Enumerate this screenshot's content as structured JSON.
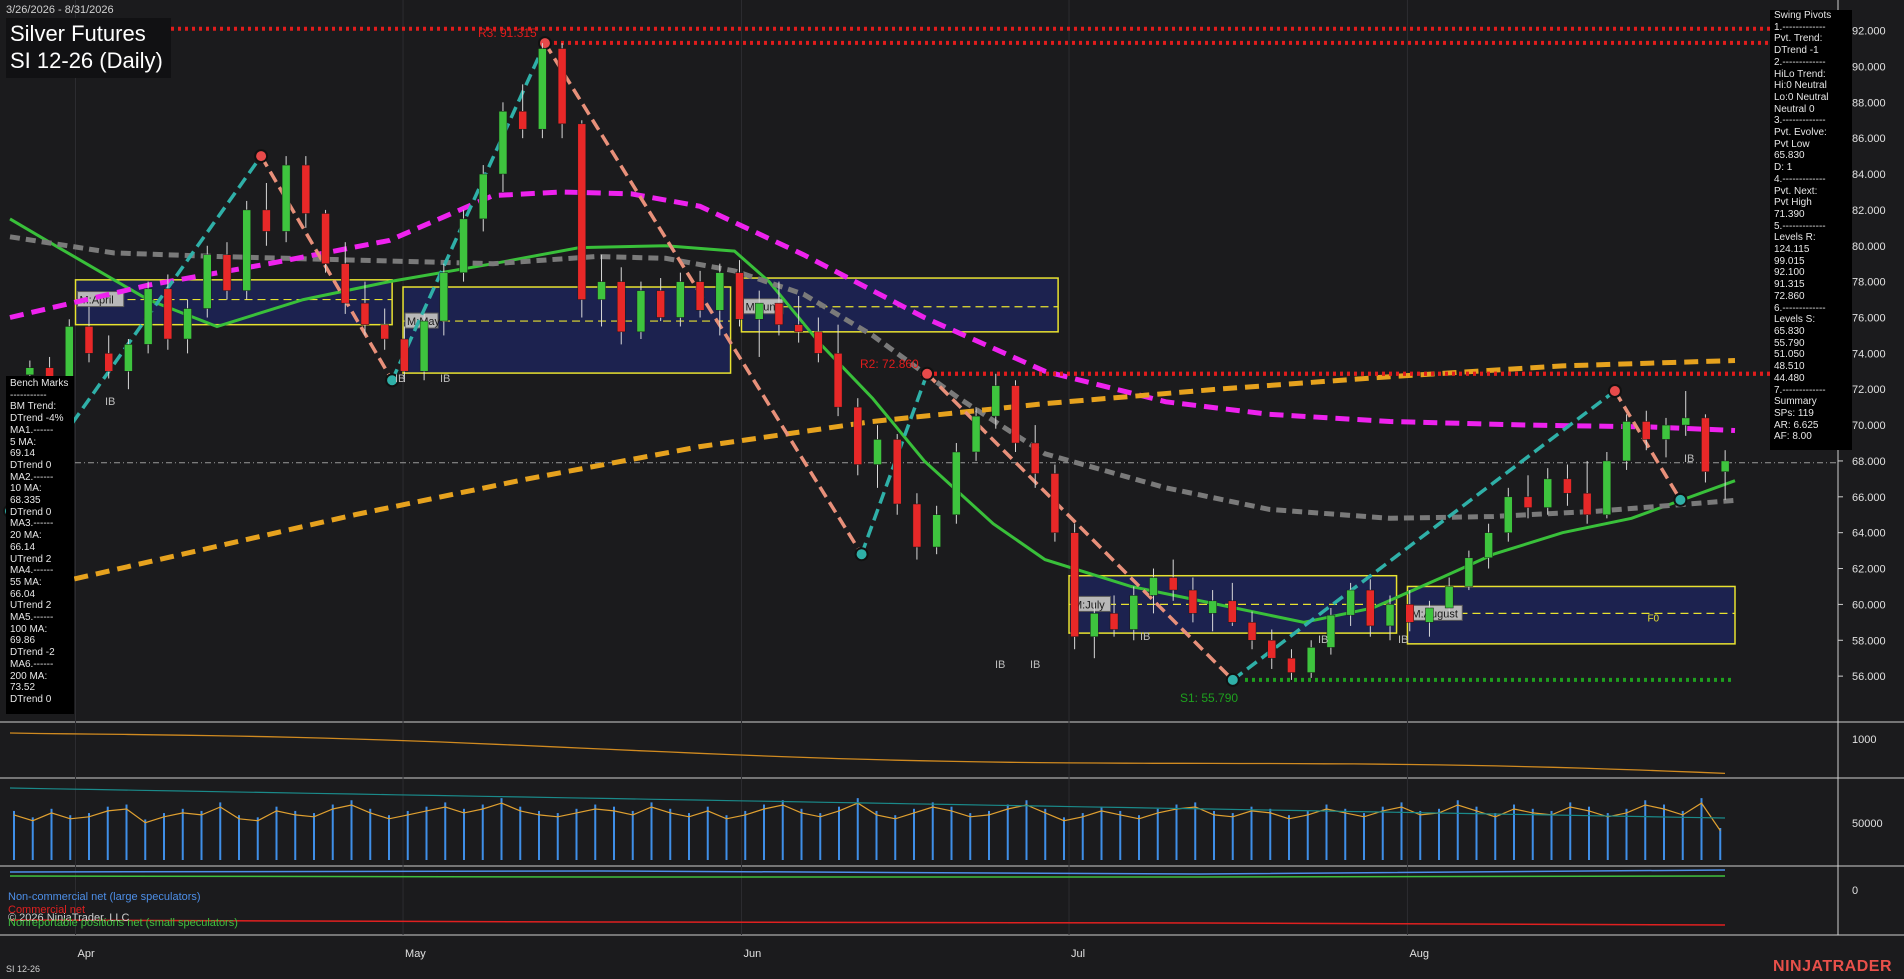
{
  "header": {
    "date_range": "3/26/2026 - 8/31/2026",
    "instrument": "Silver Futures",
    "contract": "SI 12-26 (Daily)"
  },
  "footer": {
    "symbol": "SI 12-26",
    "brand": "NINJATRADER",
    "copyright": "© 2026 NinjaTrader, LLC"
  },
  "cot_legend": {
    "noncommercial": "Non-commercial net (large speculators)",
    "commercial": "Commercial net",
    "nonreportable": "Nonreportable positions net (small speculators)"
  },
  "swing_panel": [
    "Swing Pivots",
    "1.-------------",
    "Pvt. Trend:",
    "DTrend -1",
    "2.-------------",
    "HiLo Trend:",
    "Hi:0 Neutral",
    "Lo:0 Neutral",
    "Neutral 0",
    "3.-------------",
    "Pvt. Evolve:",
    "Pvt Low",
    "65.830",
    "D: 1",
    "4.-------------",
    "Pvt. Next:",
    "Pvt High",
    "71.390",
    "5.-------------",
    "Levels R:",
    "124.115",
    "99.015",
    "92.100",
    "91.315",
    "72.860",
    "6.-------------",
    "Levels S:",
    "65.830",
    "55.790",
    "51.050",
    "48.510",
    "44.480",
    "7.-------------",
    "Summary",
    "SPs: 119",
    "AR: 6.625",
    "AF: 8.00"
  ],
  "bench_panel": [
    "Bench Marks",
    "-----------",
    "BM Trend:",
    "DTrend -4%",
    "MA1.------",
    "5 MA:",
    "69.14",
    "DTrend 0",
    "MA2.------",
    "10 MA:",
    "68.335",
    "DTrend 0",
    "MA3.------",
    "20 MA:",
    "66.14",
    "UTrend 2",
    "MA4.------",
    "55 MA:",
    "66.04",
    "UTrend 2",
    "MA5.------",
    "100 MA:",
    "69.86",
    "DTrend -2",
    "MA6.------",
    "200 MA:",
    "73.52",
    "DTrend 0"
  ],
  "chart_data": {
    "type": "candlestick",
    "x_axis": {
      "ticks": [
        "Apr",
        "May",
        "Jun",
        "Jul",
        "Aug"
      ]
    },
    "y_axis": {
      "range": [
        54,
        93
      ],
      "ticks": [
        "56.000",
        "58.000",
        "60.000",
        "62.000",
        "64.000",
        "66.000",
        "68.000",
        "70.000",
        "72.000",
        "74.000",
        "76.000",
        "78.000",
        "80.000",
        "82.000",
        "84.000",
        "86.000",
        "88.000",
        "90.000",
        "92.000"
      ]
    },
    "sub_axes": {
      "oi_tick": "1000",
      "volume_tick": "50000",
      "cot_tick": "0"
    },
    "levels": [
      {
        "label": "R3: 91.315",
        "value": 91.315,
        "color": "#e01c1c"
      },
      {
        "label": "",
        "value": 92.1,
        "color": "#e01c1c"
      },
      {
        "label": "R2: 72.860",
        "value": 72.86,
        "color": "#e01c1c"
      },
      {
        "label": "",
        "value": 72.86,
        "color": "#e01c1c"
      },
      {
        "label": "S1: 55.790",
        "value": 55.79,
        "color": "#1ea01e"
      }
    ],
    "last_price": 67.9,
    "swing_points": [
      {
        "date": "2026-03-26",
        "value": 65.2
      },
      {
        "date": "2026-04-18",
        "value": 85.0
      },
      {
        "date": "2026-04-30",
        "value": 72.5
      },
      {
        "date": "2026-05-14",
        "value": 91.3
      },
      {
        "date": "2026-06-12",
        "value": 62.8
      },
      {
        "date": "2026-06-18",
        "value": 72.86
      },
      {
        "date": "2026-07-16",
        "value": 55.79
      },
      {
        "date": "2026-08-20",
        "value": 71.9
      },
      {
        "date": "2026-08-26",
        "value": 65.83
      }
    ],
    "monthly_boxes": [
      {
        "label": "M:April",
        "start": "2026-04-01",
        "end": "2026-04-30",
        "high": 78.1,
        "low": 75.6,
        "mid": 77.0
      },
      {
        "label": "M:May",
        "start": "2026-05-01",
        "end": "2026-05-31",
        "high": 77.7,
        "low": 72.9,
        "mid": 75.8
      },
      {
        "label": "M:June",
        "start": "2026-06-01",
        "end": "2026-06-30",
        "high": 78.2,
        "low": 75.2,
        "mid": 76.6
      },
      {
        "label": "M:July",
        "start": "2026-07-01",
        "end": "2026-07-31",
        "high": 61.6,
        "low": 58.4,
        "mid": 60.0
      },
      {
        "label": "M:August",
        "start": "2026-08-01",
        "end": "2026-08-31",
        "high": 61.0,
        "low": 57.8,
        "mid": 59.5
      }
    ],
    "box_tags": [
      "F0"
    ],
    "ib_marks": [
      "IB"
    ],
    "moving_averages": [
      {
        "name": "",
        "color": "#39c03a",
        "style": "solid",
        "points": [
          [
            0,
            81.5
          ],
          [
            0.03,
            79.8
          ],
          [
            0.08,
            77.0
          ],
          [
            0.12,
            75.5
          ],
          [
            0.17,
            77.0
          ],
          [
            0.22,
            78.0
          ],
          [
            0.28,
            79.0
          ],
          [
            0.33,
            79.9
          ],
          [
            0.38,
            80.0
          ],
          [
            0.42,
            79.7
          ],
          [
            0.44,
            78.0
          ],
          [
            0.47,
            74.5
          ],
          [
            0.5,
            71.5
          ],
          [
            0.53,
            68.0
          ],
          [
            0.57,
            64.5
          ],
          [
            0.6,
            62.5
          ],
          [
            0.65,
            61.0
          ],
          [
            0.7,
            60.0
          ],
          [
            0.75,
            59.0
          ],
          [
            0.79,
            59.8
          ],
          [
            0.83,
            61.5
          ],
          [
            0.86,
            62.8
          ],
          [
            0.9,
            64.0
          ],
          [
            0.94,
            64.8
          ],
          [
            1,
            66.9
          ]
        ]
      },
      {
        "name": "",
        "color": "#7a7a7a",
        "style": "dashed",
        "points": [
          [
            0,
            80.5
          ],
          [
            0.06,
            79.6
          ],
          [
            0.12,
            79.4
          ],
          [
            0.2,
            79.2
          ],
          [
            0.28,
            79.0
          ],
          [
            0.34,
            79.4
          ],
          [
            0.38,
            79.3
          ],
          [
            0.42,
            78.6
          ],
          [
            0.46,
            77.3
          ],
          [
            0.5,
            75.0
          ],
          [
            0.55,
            71.5
          ],
          [
            0.6,
            68.4
          ],
          [
            0.67,
            66.5
          ],
          [
            0.73,
            65.3
          ],
          [
            0.8,
            64.8
          ],
          [
            0.86,
            64.9
          ],
          [
            0.92,
            65.2
          ],
          [
            1,
            65.8
          ]
        ]
      },
      {
        "name": "",
        "color": "#ee22ee",
        "style": "dashed",
        "points": [
          [
            0,
            76.0
          ],
          [
            0.08,
            77.8
          ],
          [
            0.15,
            79.0
          ],
          [
            0.22,
            80.3
          ],
          [
            0.28,
            82.8
          ],
          [
            0.32,
            83.0
          ],
          [
            0.36,
            82.9
          ],
          [
            0.4,
            82.2
          ],
          [
            0.46,
            79.5
          ],
          [
            0.53,
            76.0
          ],
          [
            0.6,
            73.0
          ],
          [
            0.67,
            71.3
          ],
          [
            0.73,
            70.6
          ],
          [
            0.8,
            70.2
          ],
          [
            0.88,
            70.0
          ],
          [
            0.95,
            69.9
          ],
          [
            1,
            69.7
          ]
        ]
      },
      {
        "name": "",
        "color": "#e6a21e",
        "style": "dashed",
        "points": [
          [
            0,
            60.6
          ],
          [
            0.1,
            62.8
          ],
          [
            0.2,
            65.0
          ],
          [
            0.3,
            67.0
          ],
          [
            0.4,
            68.8
          ],
          [
            0.5,
            70.2
          ],
          [
            0.6,
            71.2
          ],
          [
            0.7,
            72.0
          ],
          [
            0.8,
            72.7
          ],
          [
            0.9,
            73.3
          ],
          [
            1,
            73.6
          ]
        ]
      }
    ],
    "candles": [
      {
        "o": 72.8,
        "h": 73.6,
        "l": 71.8,
        "c": 73.2
      },
      {
        "o": 73.2,
        "h": 73.8,
        "l": 72.4,
        "c": 72.6
      },
      {
        "o": 72.6,
        "h": 75.9,
        "l": 72.2,
        "c": 75.5
      },
      {
        "o": 75.5,
        "h": 76.6,
        "l": 73.5,
        "c": 74.0
      },
      {
        "o": 74.0,
        "h": 75.0,
        "l": 72.6,
        "c": 73.0
      },
      {
        "o": 73.0,
        "h": 74.8,
        "l": 72.0,
        "c": 74.5
      },
      {
        "o": 74.5,
        "h": 78.0,
        "l": 74.0,
        "c": 77.6
      },
      {
        "o": 77.6,
        "h": 78.4,
        "l": 74.2,
        "c": 74.8
      },
      {
        "o": 74.8,
        "h": 77.0,
        "l": 74.0,
        "c": 76.5
      },
      {
        "o": 76.5,
        "h": 80.0,
        "l": 76.0,
        "c": 79.5
      },
      {
        "o": 79.5,
        "h": 80.2,
        "l": 77.0,
        "c": 77.5
      },
      {
        "o": 77.5,
        "h": 82.5,
        "l": 77.0,
        "c": 82.0
      },
      {
        "o": 82.0,
        "h": 83.5,
        "l": 80.0,
        "c": 80.8
      },
      {
        "o": 80.8,
        "h": 85.0,
        "l": 80.2,
        "c": 84.5
      },
      {
        "o": 84.5,
        "h": 85.0,
        "l": 81.0,
        "c": 81.8
      },
      {
        "o": 81.8,
        "h": 82.0,
        "l": 78.5,
        "c": 79.0
      },
      {
        "o": 79.0,
        "h": 80.2,
        "l": 76.2,
        "c": 76.8
      },
      {
        "o": 76.8,
        "h": 78.0,
        "l": 75.0,
        "c": 75.6
      },
      {
        "o": 75.6,
        "h": 76.5,
        "l": 74.2,
        "c": 74.8
      },
      {
        "o": 74.8,
        "h": 75.5,
        "l": 72.4,
        "c": 73.0
      },
      {
        "o": 73.0,
        "h": 76.2,
        "l": 72.5,
        "c": 75.8
      },
      {
        "o": 75.8,
        "h": 79.0,
        "l": 75.0,
        "c": 78.5
      },
      {
        "o": 78.5,
        "h": 82.0,
        "l": 78.0,
        "c": 81.5
      },
      {
        "o": 81.5,
        "h": 84.5,
        "l": 80.8,
        "c": 84.0
      },
      {
        "o": 84.0,
        "h": 88.0,
        "l": 83.0,
        "c": 87.5
      },
      {
        "o": 87.5,
        "h": 89.0,
        "l": 86.0,
        "c": 86.5
      },
      {
        "o": 86.5,
        "h": 91.3,
        "l": 86.0,
        "c": 91.0
      },
      {
        "o": 91.0,
        "h": 91.3,
        "l": 86.0,
        "c": 86.8
      },
      {
        "o": 86.8,
        "h": 87.0,
        "l": 76.0,
        "c": 77.0
      },
      {
        "o": 77.0,
        "h": 79.5,
        "l": 75.5,
        "c": 78.0
      },
      {
        "o": 78.0,
        "h": 78.8,
        "l": 74.5,
        "c": 75.2
      },
      {
        "o": 75.2,
        "h": 78.0,
        "l": 74.8,
        "c": 77.5
      },
      {
        "o": 77.5,
        "h": 78.2,
        "l": 75.8,
        "c": 76.0
      },
      {
        "o": 76.0,
        "h": 78.5,
        "l": 75.5,
        "c": 78.0
      },
      {
        "o": 78.0,
        "h": 78.6,
        "l": 76.0,
        "c": 76.4
      },
      {
        "o": 76.4,
        "h": 79.0,
        "l": 75.0,
        "c": 78.5
      },
      {
        "o": 78.5,
        "h": 79.2,
        "l": 75.5,
        "c": 75.9
      },
      {
        "o": 75.9,
        "h": 77.5,
        "l": 73.8,
        "c": 76.8
      },
      {
        "o": 76.8,
        "h": 78.0,
        "l": 75.0,
        "c": 75.6
      },
      {
        "o": 75.6,
        "h": 77.2,
        "l": 74.6,
        "c": 75.2
      },
      {
        "o": 75.2,
        "h": 76.0,
        "l": 73.5,
        "c": 74.0
      },
      {
        "o": 74.0,
        "h": 75.6,
        "l": 70.5,
        "c": 71.0
      },
      {
        "o": 71.0,
        "h": 71.5,
        "l": 67.2,
        "c": 67.8
      },
      {
        "o": 67.8,
        "h": 70.0,
        "l": 66.5,
        "c": 69.2
      },
      {
        "o": 69.2,
        "h": 69.5,
        "l": 65.0,
        "c": 65.6
      },
      {
        "o": 65.6,
        "h": 66.2,
        "l": 62.5,
        "c": 63.2
      },
      {
        "o": 63.2,
        "h": 65.5,
        "l": 62.8,
        "c": 65.0
      },
      {
        "o": 65.0,
        "h": 69.0,
        "l": 64.5,
        "c": 68.5
      },
      {
        "o": 68.5,
        "h": 71.0,
        "l": 68.0,
        "c": 70.5
      },
      {
        "o": 70.5,
        "h": 72.86,
        "l": 69.8,
        "c": 72.2
      },
      {
        "o": 72.2,
        "h": 72.5,
        "l": 68.5,
        "c": 69.0
      },
      {
        "o": 69.0,
        "h": 70.0,
        "l": 66.5,
        "c": 67.3
      },
      {
        "o": 67.3,
        "h": 67.8,
        "l": 63.5,
        "c": 64.0
      },
      {
        "o": 64.0,
        "h": 64.5,
        "l": 57.5,
        "c": 58.2
      },
      {
        "o": 58.2,
        "h": 60.0,
        "l": 57.0,
        "c": 59.5
      },
      {
        "o": 59.5,
        "h": 60.5,
        "l": 58.2,
        "c": 58.6
      },
      {
        "o": 58.6,
        "h": 61.0,
        "l": 58.0,
        "c": 60.5
      },
      {
        "o": 60.5,
        "h": 62.0,
        "l": 59.5,
        "c": 61.5
      },
      {
        "o": 61.5,
        "h": 62.5,
        "l": 60.2,
        "c": 60.8
      },
      {
        "o": 60.8,
        "h": 61.5,
        "l": 59.0,
        "c": 59.5
      },
      {
        "o": 59.5,
        "h": 60.8,
        "l": 58.5,
        "c": 60.2
      },
      {
        "o": 60.2,
        "h": 61.2,
        "l": 58.8,
        "c": 59.0
      },
      {
        "o": 59.0,
        "h": 59.6,
        "l": 57.5,
        "c": 58.0
      },
      {
        "o": 58.0,
        "h": 58.6,
        "l": 56.4,
        "c": 57.0
      },
      {
        "o": 57.0,
        "h": 57.5,
        "l": 55.79,
        "c": 56.2
      },
      {
        "o": 56.2,
        "h": 58.0,
        "l": 55.9,
        "c": 57.6
      },
      {
        "o": 57.6,
        "h": 59.8,
        "l": 57.2,
        "c": 59.4
      },
      {
        "o": 59.4,
        "h": 61.2,
        "l": 58.8,
        "c": 60.8
      },
      {
        "o": 60.8,
        "h": 61.4,
        "l": 58.2,
        "c": 58.8
      },
      {
        "o": 58.8,
        "h": 60.5,
        "l": 58.0,
        "c": 60.0
      },
      {
        "o": 60.0,
        "h": 60.8,
        "l": 58.5,
        "c": 59.0
      },
      {
        "o": 59.0,
        "h": 60.2,
        "l": 58.2,
        "c": 59.8
      },
      {
        "o": 59.8,
        "h": 61.5,
        "l": 59.4,
        "c": 61.0
      },
      {
        "o": 61.0,
        "h": 63.0,
        "l": 60.8,
        "c": 62.6
      },
      {
        "o": 62.6,
        "h": 64.5,
        "l": 62.0,
        "c": 64.0
      },
      {
        "o": 64.0,
        "h": 66.5,
        "l": 63.5,
        "c": 66.0
      },
      {
        "o": 66.0,
        "h": 67.2,
        "l": 64.8,
        "c": 65.4
      },
      {
        "o": 65.4,
        "h": 67.6,
        "l": 65.0,
        "c": 67.0
      },
      {
        "o": 67.0,
        "h": 67.8,
        "l": 65.5,
        "c": 66.2
      },
      {
        "o": 66.2,
        "h": 68.0,
        "l": 64.5,
        "c": 65.0
      },
      {
        "o": 65.0,
        "h": 68.5,
        "l": 64.8,
        "c": 68.0
      },
      {
        "o": 68.0,
        "h": 70.6,
        "l": 67.5,
        "c": 70.2
      },
      {
        "o": 70.2,
        "h": 70.8,
        "l": 68.6,
        "c": 69.2
      },
      {
        "o": 69.2,
        "h": 70.4,
        "l": 68.2,
        "c": 70.0
      },
      {
        "o": 70.0,
        "h": 71.9,
        "l": 69.4,
        "c": 70.4
      },
      {
        "o": 70.4,
        "h": 70.6,
        "l": 66.8,
        "c": 67.4
      },
      {
        "o": 67.4,
        "h": 68.6,
        "l": 65.83,
        "c": 68.0
      }
    ],
    "volumes": [
      46,
      40,
      48,
      42,
      44,
      50,
      52,
      38,
      44,
      48,
      46,
      54,
      42,
      40,
      50,
      46,
      44,
      52,
      56,
      48,
      42,
      46,
      50,
      54,
      48,
      52,
      58,
      50,
      46,
      44,
      48,
      52,
      50,
      46,
      54,
      48,
      44,
      50,
      42,
      46,
      52,
      56,
      48,
      44,
      50,
      58,
      46,
      42,
      48,
      54,
      50,
      44,
      46,
      52,
      56,
      48,
      40,
      44,
      50,
      46,
      42,
      48,
      52,
      54,
      46,
      44,
      50,
      48,
      42,
      46,
      52,
      48,
      44,
      50,
      54,
      46,
      48,
      56,
      50,
      44,
      52,
      48,
      46,
      54,
      50,
      44,
      48,
      56,
      52,
      46,
      58,
      30
    ]
  }
}
